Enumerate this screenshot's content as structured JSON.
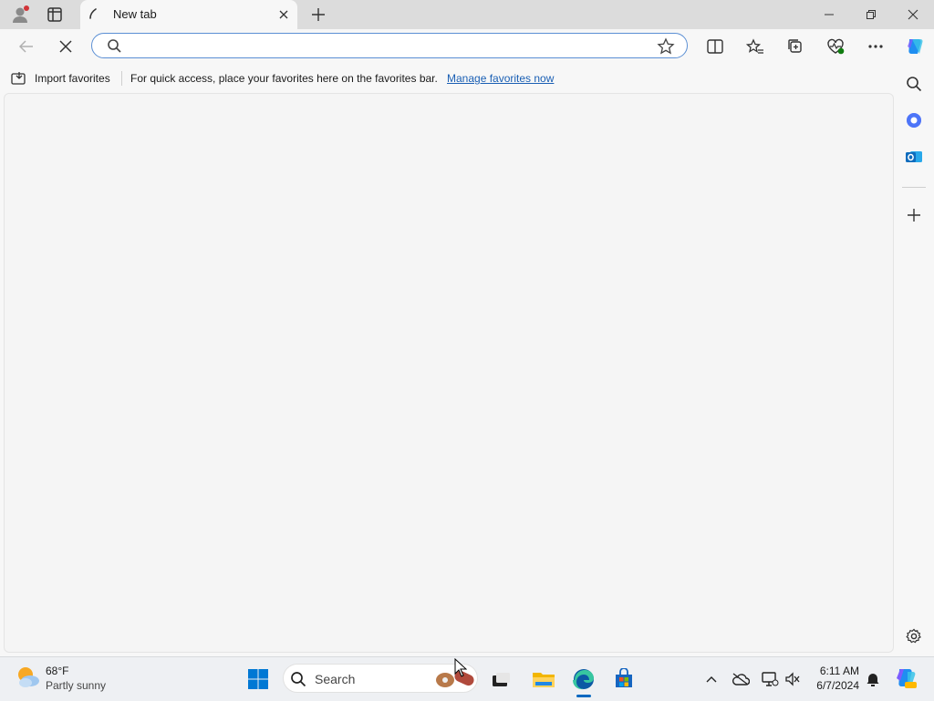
{
  "tab": {
    "title": "New tab"
  },
  "address_bar": {
    "value": "",
    "placeholder": ""
  },
  "favorites_bar": {
    "import_label": "Import favorites",
    "message": "For quick access, place your favorites here on the favorites bar.",
    "manage_link": "Manage favorites now"
  },
  "taskbar": {
    "weather_temp": "68°F",
    "weather_desc": "Partly sunny",
    "search_label": "Search",
    "time": "6:11 AM",
    "date": "6/7/2024"
  },
  "colors": {
    "accent": "#0067c0",
    "address_border": "#5b8fd4",
    "link": "#1a5fb4"
  },
  "icons": [
    "profile-icon",
    "workspaces-icon",
    "tab-loading-icon",
    "close-icon",
    "plus-icon",
    "minimize-icon",
    "restore-icon",
    "back-icon",
    "stop-icon",
    "search-icon",
    "star-icon",
    "split-screen-icon",
    "favorites-icon",
    "collections-icon",
    "browser-essentials-icon",
    "more-icon",
    "copilot-icon",
    "outlook-icon",
    "settings-icon",
    "windows-start-icon",
    "edge-icon",
    "file-explorer-icon",
    "store-icon",
    "wifi-icon",
    "speaker-icon"
  ]
}
